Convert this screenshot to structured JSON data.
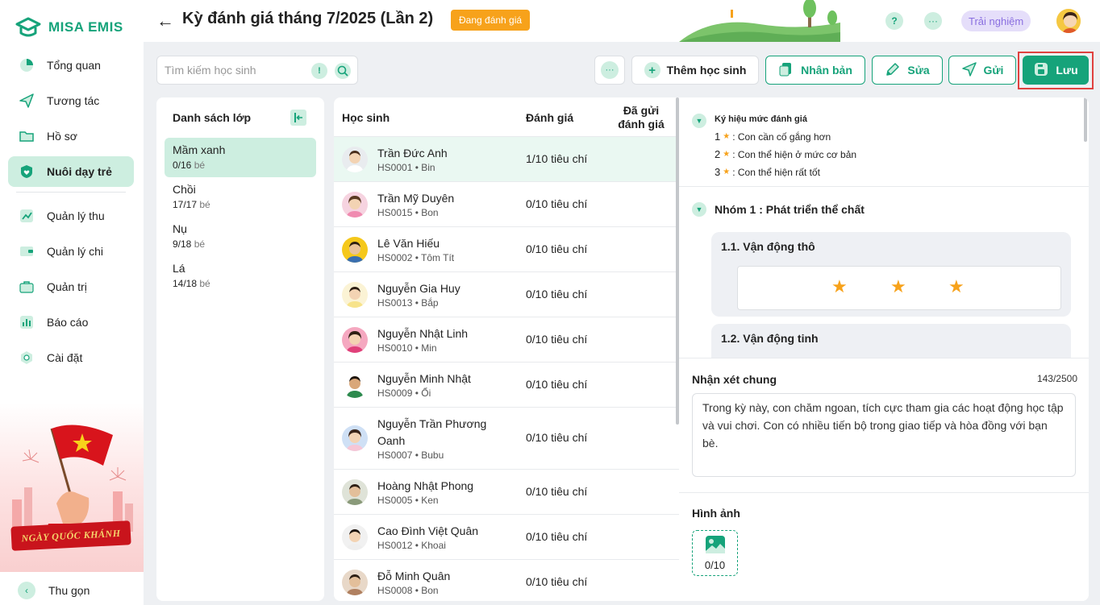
{
  "app": {
    "name": "MISA EMIS"
  },
  "sidebar": {
    "items": [
      {
        "label": "Tổng quan",
        "icon": "pie-chart-icon"
      },
      {
        "label": "Tương tác",
        "icon": "paper-plane-icon"
      },
      {
        "label": "Hồ sơ",
        "icon": "folder-icon"
      },
      {
        "label": "Nuôi dạy trẻ",
        "icon": "heart-shield-icon",
        "active": true
      },
      {
        "label": "Quản lý thu",
        "icon": "trend-chart-icon"
      },
      {
        "label": "Quản lý chi",
        "icon": "wallet-icon"
      },
      {
        "label": "Quản trị",
        "icon": "briefcase-icon"
      },
      {
        "label": "Báo cáo",
        "icon": "bar-chart-icon"
      },
      {
        "label": "Cài đặt",
        "icon": "gear-icon"
      }
    ],
    "banner_text": "NGÀY QUỐC KHÁNH",
    "collapse_label": "Thu gọn"
  },
  "header": {
    "title": "Kỳ đánh giá tháng 7/2025 (Lần 2)",
    "status": "Đang đánh giá",
    "help": "?",
    "more": "···",
    "trial": "Trải nghiệm"
  },
  "toolbar": {
    "search_placeholder": "Tìm kiếm học sinh",
    "search_info": "!",
    "more": "···",
    "add_student": "Thêm học sinh",
    "duplicate": "Nhân bản",
    "edit": "Sửa",
    "send": "Gửi",
    "save": "Lưu"
  },
  "classes": {
    "title": "Danh sách lớp",
    "unit": "bé",
    "items": [
      {
        "name": "Mầm xanh",
        "count": "0/16",
        "active": true
      },
      {
        "name": "Chồi",
        "count": "17/17"
      },
      {
        "name": "Nụ",
        "count": "9/18"
      },
      {
        "name": "Lá",
        "count": "14/18"
      }
    ]
  },
  "students": {
    "columns": {
      "name": "Học sinh",
      "evaluation": "Đánh giá",
      "sent_line1": "Đã gửi",
      "sent_line2": "đánh giá"
    },
    "rows": [
      {
        "name": "Trần Đức Anh",
        "code": "HS0001 • Bin",
        "evaluation": "1/10 tiêu chí",
        "active": true
      },
      {
        "name": "Trần Mỹ Duyên",
        "code": "HS0015 • Bon",
        "evaluation": "0/10 tiêu chí"
      },
      {
        "name": "Lê Văn Hiếu",
        "code": "HS0002 • Tôm Tít",
        "evaluation": "0/10 tiêu chí"
      },
      {
        "name": "Nguyễn Gia Huy",
        "code": "HS0013 • Bắp",
        "evaluation": "0/10 tiêu chí"
      },
      {
        "name": "Nguyễn Nhật Linh",
        "code": "HS0010 • Min",
        "evaluation": "0/10 tiêu chí"
      },
      {
        "name": "Nguyễn Minh Nhật",
        "code": "HS0009 • Ổi",
        "evaluation": "0/10 tiêu chí"
      },
      {
        "name": "Nguyễn Trần Phương Oanh",
        "code": "HS0007 • Bubu",
        "evaluation": "0/10 tiêu chí",
        "tall": true
      },
      {
        "name": "Hoàng Nhật Phong",
        "code": "HS0005 • Ken",
        "evaluation": "0/10 tiêu chí"
      },
      {
        "name": "Cao Đình Việt Quân",
        "code": "HS0012 • Khoai",
        "evaluation": "0/10 tiêu chí"
      },
      {
        "name": "Đỗ Minh Quân",
        "code": "HS0008 • Bon",
        "evaluation": "0/10 tiêu chí"
      }
    ]
  },
  "detail": {
    "legend_title": "Ký hiệu mức đánh giá",
    "legend": [
      {
        "level": "1",
        "text": ": Con cần cố gắng hơn"
      },
      {
        "level": "2",
        "text": ": Con thể hiện ở mức cơ bản"
      },
      {
        "level": "3",
        "text": ": Con thể hiện rất tốt"
      }
    ],
    "group_title": "Nhóm 1 : Phát triển thể chất",
    "criteria": [
      {
        "title": "1.1. Vận động thô",
        "stars": 3
      },
      {
        "title": "1.2. Vận động tinh"
      }
    ],
    "comment_label": "Nhận xét chung",
    "comment_count": "143/2500",
    "comment_text": "Trong kỳ này, con chăm ngoan, tích cực tham gia các hoạt động học tập và vui chơi. Con có nhiều tiến bộ trong giao tiếp và hòa đồng với bạn bè.",
    "image_label": "Hình ảnh",
    "image_count": "0/10"
  },
  "colors": {
    "accent": "#16a37a",
    "accent_light": "#cdeee0",
    "warning": "#f7a21b",
    "highlight": "#e0413f",
    "trial": "#8a6fe0"
  }
}
